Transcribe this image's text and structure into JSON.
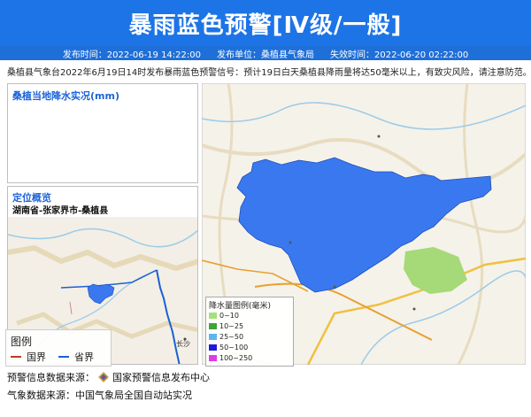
{
  "header": {
    "title": "暴雨蓝色预警[Ⅳ级/一般]",
    "issue_time": "发布时间：2022-06-19 14:22:00",
    "issuer": "发布单位：桑植县气象局",
    "expire_time": "失效时间：2022-06-20 02:22:00"
  },
  "notice": "桑植县气象台2022年6月19日14时发布暴雨蓝色预警信号：预计19日白天桑植县降雨量将达50毫米以上，有致灾风险，请注意防范。",
  "rain_panel": {
    "title": "桑植当地降水实况(mm)"
  },
  "location_panel": {
    "title": "定位概览",
    "location": "湖南省-张家界市-桑植县",
    "city_label": "长沙"
  },
  "legend": {
    "title": "图例",
    "items": [
      {
        "label": "国界",
        "color": "#c0392b"
      },
      {
        "label": "省界",
        "color": "#1d5fd6"
      }
    ]
  },
  "rain_legend": {
    "title": "降水量图例(毫米)",
    "items": [
      {
        "label": "0~10",
        "color": "#a6e07a"
      },
      {
        "label": "10~25",
        "color": "#3ea33a"
      },
      {
        "label": "25~50",
        "color": "#5ab6f0"
      },
      {
        "label": "50~100",
        "color": "#1f1ad8"
      },
      {
        "label": "100~250",
        "color": "#e13be6"
      }
    ]
  },
  "footer": {
    "warning_source_prefix": "预警信息数据来源：",
    "warning_source": "国家预警信息发布中心",
    "weather_source": "气象数据来源：中国气象局全国自动站实况"
  },
  "colors": {
    "banner": "#1d74e6",
    "warning_area": "#3a78f0",
    "green_area": "#a6d977"
  }
}
